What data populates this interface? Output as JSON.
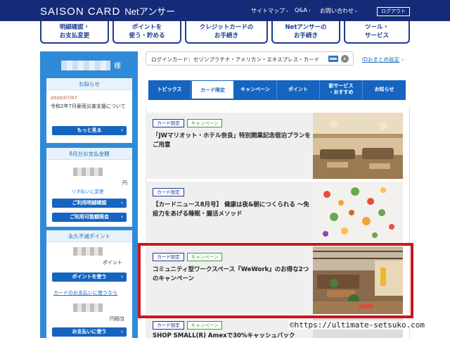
{
  "header": {
    "logo": "SAISON CARD",
    "logo_sub": "Netアンサー",
    "links": [
      "サイトマップ",
      "Q&A",
      "お問い合わせ"
    ],
    "logout": "ログアウト"
  },
  "main_menu": [
    [
      "明細確認・",
      "お支払変更"
    ],
    [
      "ポイントを",
      "使う・貯める"
    ],
    [
      "クレジットカードの",
      "お手続き"
    ],
    [
      "Netアンサーの",
      "お手続き"
    ],
    [
      "ツール・",
      "サービス"
    ]
  ],
  "sidebar": {
    "honorific": "様",
    "notice_title": "お知らせ",
    "notice_date": "2020/07/07",
    "notice_text": "令和2年7月豪雨災害支援について",
    "more_button": "もっと見る",
    "payment_title": "8月分お支払金額",
    "payment_unit": "円",
    "revo_link": "リボ払いに変更",
    "statement_button": "ご利用明細確認",
    "available_button": "ご利用可能額照会",
    "points_title": "永久不滅ポイント",
    "points_unit": "ポイント",
    "use_points_button": "ポイントを使う",
    "card_payment_link": "カードのお支払いに使うなら",
    "yen_equivalent": "円相当",
    "pay_with_points_button": "お支払いに使う"
  },
  "login_bar": {
    "label": "ログインカード：セゾンプラチナ・アメリカン・エキスプレス・カード",
    "id_link": "IDおまとめ設定"
  },
  "tabs": [
    [
      "トピックス"
    ],
    [
      "カード限定"
    ],
    [
      "キャンペーン"
    ],
    [
      "ポイント"
    ],
    [
      "新サービス",
      "・おすすめ"
    ],
    [
      "お知らせ"
    ]
  ],
  "active_tab": 1,
  "articles": [
    {
      "badges": [
        "カード限定",
        "キャンペーン"
      ],
      "title": "「JWマリオット・ホテル奈良」特別開業記念宿泊プランをご用意"
    },
    {
      "badges": [
        "カード限定"
      ],
      "title": "【カードニュース8月号】 健康は夜&朝につくられる ～免疫力をあげる睡眠・腸活メソッド"
    },
    {
      "badges": [
        "カード限定",
        "キャンペーン"
      ],
      "title": "コミュニティ型ワークスペース『WeWork』のお得な2つのキャンペーン"
    },
    {
      "badges": [
        "カード限定",
        "キャンペーン"
      ],
      "title": "SHOP SMALL(R) Amexで30%キャッシュバック"
    }
  ],
  "watermark": "©https://ultimate-setsuko.com",
  "colors": {
    "header_bg": "#152b78",
    "sidebar_bg": "#2f8ad8",
    "tab_bg": "#1565c0",
    "highlight": "#c8181e",
    "badge_green": "#3c9a2e"
  }
}
